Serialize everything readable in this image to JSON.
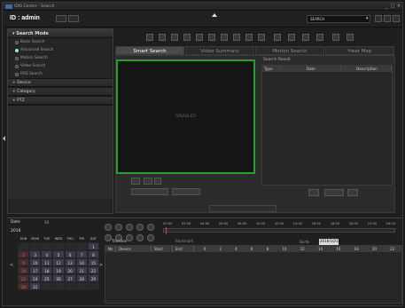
{
  "window": {
    "title": "IDIS Center - Search",
    "buttons": [
      "_",
      "□",
      "×"
    ]
  },
  "topbar": {
    "user_id": "ID : admin",
    "search_placeholder": "SEARCH"
  },
  "left_panel": {
    "search_mode": {
      "header": "Search Mode",
      "items": [
        {
          "label": "Basic Search",
          "selected": false
        },
        {
          "label": "Advanced Search",
          "selected": true
        },
        {
          "label": "Motion Search",
          "selected": false
        },
        {
          "label": "Video Search",
          "selected": false
        },
        {
          "label": "POS Search",
          "selected": false
        }
      ]
    },
    "sections": [
      "Device",
      "Category",
      "PTZ"
    ]
  },
  "tabs": [
    "Smart Search",
    "Video Summary",
    "Motion Search",
    "Heat Map"
  ],
  "video": {
    "label": "DISABLED"
  },
  "list": {
    "title": "Search Result",
    "columns": [
      "Type",
      "Date",
      "Description"
    ]
  },
  "bottom": {
    "date_label": "Date",
    "month": "10",
    "year": "2016",
    "calendar_header": [
      "SUN",
      "MON",
      "TUE",
      "WED",
      "THU",
      "FRI",
      "SAT"
    ],
    "calendar_rows": [
      [
        "",
        "",
        "",
        "",
        "",
        "",
        "1"
      ],
      [
        "2",
        "3",
        "4",
        "5",
        "6",
        "7",
        "8"
      ],
      [
        "9",
        "10",
        "11",
        "12",
        "13",
        "14",
        "15"
      ],
      [
        "16",
        "17",
        "18",
        "19",
        "20",
        "21",
        "22"
      ],
      [
        "23",
        "24",
        "25",
        "26",
        "27",
        "28",
        "29"
      ],
      [
        "30",
        "31",
        "",
        "",
        "",
        "",
        ""
      ]
    ],
    "timeline_labels": [
      "00:00",
      "02:00",
      "04:00",
      "06:00",
      "08:00",
      "10:00",
      "12:00",
      "14:00",
      "16:00",
      "18:00",
      "20:00",
      "22:00",
      "24:00"
    ],
    "go_to_label": "Go to",
    "go_to_value": "2016/10/15",
    "grid_columns": [
      "No",
      "Device",
      "Start",
      "End"
    ],
    "timeline_cols": [
      "0",
      "2",
      "4",
      "6",
      "8",
      "10",
      "12",
      "14",
      "16",
      "18",
      "20",
      "22"
    ],
    "tab_labels": [
      "Timeline",
      "Bookmark"
    ]
  },
  "colors": {
    "accent": "#2e9b2e",
    "background": "#1b1b1b",
    "calendar_cell": "#3b3b4a"
  }
}
